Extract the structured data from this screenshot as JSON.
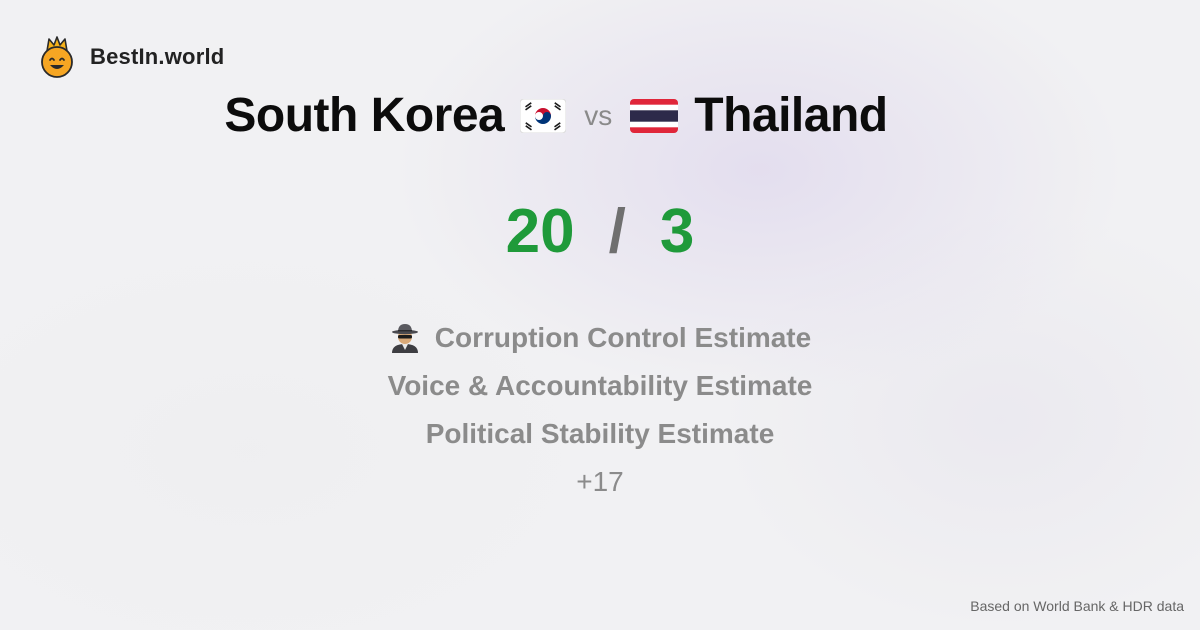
{
  "brand": {
    "name": "BestIn.world",
    "logo_icon": "smiling-face-with-crown-icon"
  },
  "comparison": {
    "country_a": "South Korea",
    "country_a_flag": "south-korea-flag-icon",
    "vs_label": "vs",
    "country_b": "Thailand",
    "country_b_flag": "thailand-flag-icon"
  },
  "score": {
    "a": "20",
    "separator": "/",
    "b": "3",
    "color": "#1f9a3a"
  },
  "metrics": [
    {
      "label": "Corruption Control Estimate",
      "icon": "spy-detective-icon"
    },
    {
      "label": "Voice & Accountability Estimate"
    },
    {
      "label": "Political Stability Estimate"
    }
  ],
  "more_label": "+17",
  "footer": {
    "source": "Based on World Bank & HDR data"
  },
  "colors": {
    "title": "#0c0c0c",
    "muted": "#8b8b8b",
    "accent": "#1f9a3a"
  }
}
